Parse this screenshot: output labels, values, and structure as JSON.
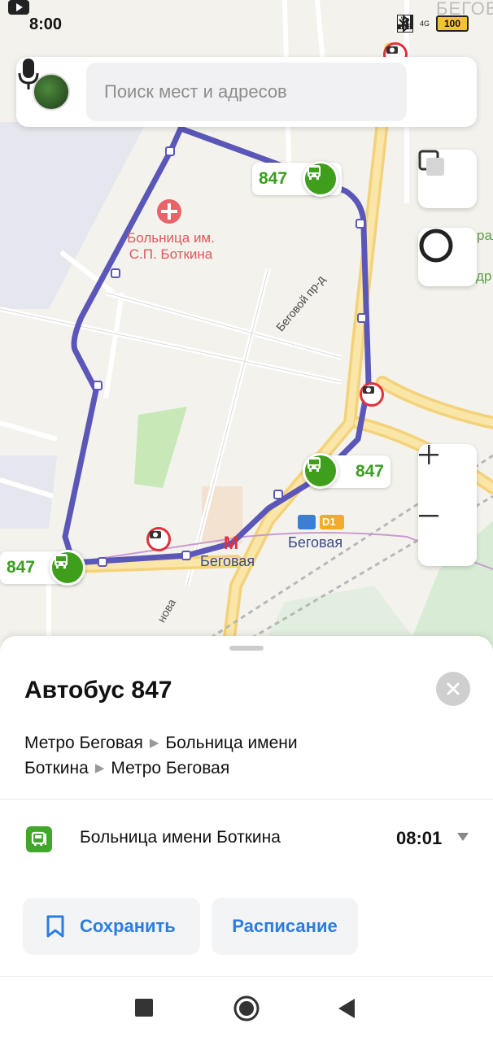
{
  "status_bar": {
    "time": "8:00",
    "battery": "100",
    "network": "4G",
    "volte": "Vo LTE"
  },
  "search": {
    "placeholder": "Поиск мест и адресов"
  },
  "map": {
    "hospital_label_line1": "Больница им.",
    "hospital_label_line2": "С.П. Боткина",
    "street_label": "Беговой пр-д",
    "metro_label": "Беговая",
    "station_label": "Беговая",
    "d1_badge": "D1",
    "route_number": "847",
    "corner_label_top": "БЕГОВ",
    "corner_label_right_1": "рал",
    "corner_label_right_2": "ипподр",
    "bottom_street": "нова",
    "route_color": "#5b57b8",
    "bus_color": "#3f9e1c"
  },
  "sheet": {
    "title": "Автобус 847",
    "route_stops": [
      "Метро Беговая",
      "Больница имени",
      "Боткина",
      "Метро Беговая"
    ],
    "stop": {
      "name": "Больница имени Боткина",
      "time": "08:01"
    },
    "save_label": "Сохранить",
    "schedule_label": "Расписание"
  },
  "icons": [
    "play-icon",
    "youtube-icon",
    "bluetooth-icon",
    "signal-icon",
    "battery-icon",
    "mic-icon",
    "layers-icon",
    "alice-icon",
    "zoom-in-icon",
    "zoom-out-icon",
    "close-icon",
    "bus-stop-icon",
    "chevron-down-icon",
    "bookmark-icon",
    "nav-recents-icon",
    "nav-home-icon",
    "nav-back-icon"
  ]
}
